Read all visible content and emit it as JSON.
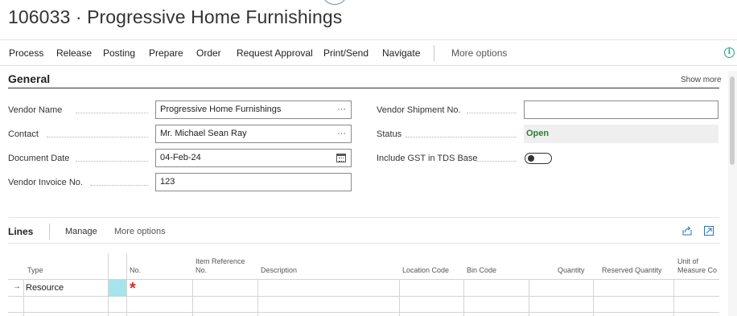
{
  "page": {
    "title": "106033 · Progressive Home Furnishings"
  },
  "actions": [
    {
      "label": "Process"
    },
    {
      "label": "Release"
    },
    {
      "label": "Posting"
    },
    {
      "label": "Prepare"
    },
    {
      "label": "Order"
    },
    {
      "label": "Request Approval"
    },
    {
      "label": "Print/Send"
    },
    {
      "label": "Navigate"
    },
    {
      "label": "More options"
    }
  ],
  "icons": {
    "info": "info-icon",
    "calendar": "calendar-icon",
    "share": "share-icon",
    "expand": "expand-icon",
    "row_arrow": "arrow-right-icon"
  },
  "general": {
    "title": "General",
    "show_more": "Show more",
    "vendor_name": {
      "label": "Vendor Name",
      "value": "Progressive Home Furnishings",
      "button": "···"
    },
    "contact": {
      "label": "Contact",
      "value": "Mr. Michael Sean Ray",
      "button": "···"
    },
    "document_date": {
      "label": "Document Date",
      "value": "04-Feb-24"
    },
    "vendor_invoice_no": {
      "label": "Vendor Invoice No.",
      "value": "123"
    },
    "vendor_shipment_no": {
      "label": "Vendor Shipment No.",
      "value": ""
    },
    "status": {
      "label": "Status",
      "value": "Open"
    },
    "include_gst": {
      "label": "Include GST in TDS Base",
      "value": false
    }
  },
  "lines": {
    "title": "Lines",
    "manage": "Manage",
    "more_options": "More options",
    "columns": [
      "Type",
      "No.",
      "Item Reference No.",
      "Description",
      "Location Code",
      "Bin Code",
      "Quantity",
      "Reserved Quantity",
      "Unit of Measure Co"
    ],
    "rows": [
      {
        "arrow": "→",
        "type": "Resource",
        "required": "*"
      }
    ]
  },
  "colors": {
    "status_open": "#2e7d32",
    "required": "#d32f2f",
    "selected_cell": "#a8e4ec",
    "accent": "#2a9d8f"
  }
}
